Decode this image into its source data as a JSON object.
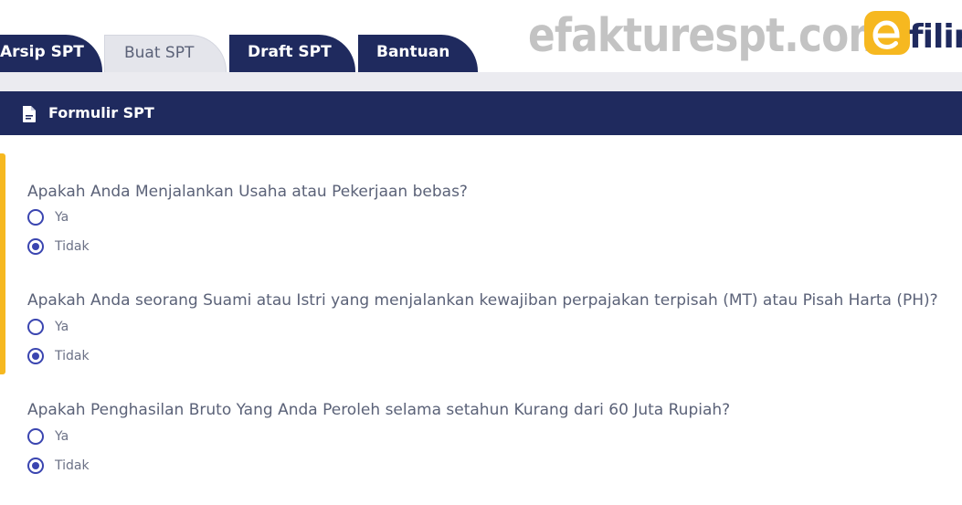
{
  "tabs": [
    {
      "label": "Arsip SPT",
      "active": false
    },
    {
      "label": "Buat SPT",
      "active": true
    },
    {
      "label": "Draft SPT",
      "active": false
    },
    {
      "label": "Bantuan",
      "active": false
    }
  ],
  "watermark": "efakturespt.com",
  "logo": {
    "text": "filin",
    "mark_letter": "e",
    "color": "#f6b820"
  },
  "form_header": {
    "icon": "document-icon",
    "title": "Formulir SPT"
  },
  "questions": [
    {
      "text": "Apakah Anda Menjalankan Usaha atau Pekerjaan bebas?",
      "options": [
        {
          "label": "Ya",
          "selected": false
        },
        {
          "label": "Tidak",
          "selected": true
        }
      ]
    },
    {
      "text": "Apakah Anda seorang Suami atau Istri yang menjalankan kewajiban perpajakan terpisah (MT) atau Pisah Harta (PH)?",
      "options": [
        {
          "label": "Ya",
          "selected": false
        },
        {
          "label": "Tidak",
          "selected": true
        }
      ]
    },
    {
      "text": "Apakah Penghasilan Bruto Yang Anda Peroleh selama setahun Kurang dari 60 Juta Rupiah?",
      "options": [
        {
          "label": "Ya",
          "selected": false
        },
        {
          "label": "Tidak",
          "selected": true
        }
      ]
    }
  ],
  "colors": {
    "navy": "#1f2a5e",
    "accent": "#f6b820",
    "radio": "#3a45b0",
    "text": "#5b6278"
  }
}
